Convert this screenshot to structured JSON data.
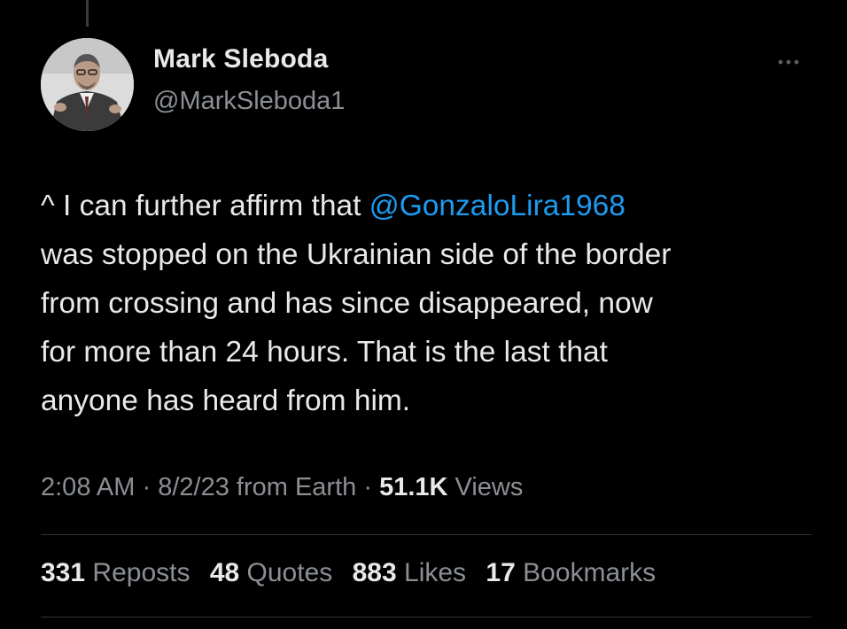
{
  "author": {
    "name": "Mark Sleboda",
    "handle": "@MarkSleboda1"
  },
  "tweet": {
    "text_before": "^ I can further affirm that ",
    "mention": "@GonzaloLira1968",
    "text_after": "\nwas stopped on the Ukrainian side of the border\nfrom crossing and has since disappeared, now\nfor more than 24 hours. That is the last that\nanyone has heard from him."
  },
  "meta": {
    "time": "2:08 AM",
    "separator": "·",
    "date": "8/2/23",
    "source": "from Earth",
    "views_count": "51.1K",
    "views_label": "Views"
  },
  "stats": [
    {
      "count": "331",
      "label": "Reposts"
    },
    {
      "count": "48",
      "label": "Quotes"
    },
    {
      "count": "883",
      "label": "Likes"
    },
    {
      "count": "17",
      "label": "Bookmarks"
    }
  ],
  "icons": {
    "more": "more-options-icon"
  },
  "colors": {
    "background": "#000000",
    "text": "#e7e9ea",
    "secondary": "#8b8f94",
    "link": "#1d9bf0",
    "divider": "#2f3336"
  }
}
